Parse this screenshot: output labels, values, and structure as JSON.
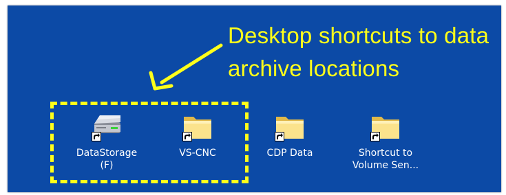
{
  "annotation": {
    "text": "Desktop shortcuts to data\narchive locations",
    "color": "#ffff1a"
  },
  "desktop": {
    "background_color": "#0c4aa6",
    "icons": [
      {
        "label": "DataStorage\n(F)",
        "icon": "drive-icon",
        "shortcut": true
      },
      {
        "label": "VS-CNC",
        "icon": "folder-icon",
        "shortcut": true
      },
      {
        "label": "CDP Data",
        "icon": "folder-icon",
        "shortcut": true
      },
      {
        "label": "Shortcut to\nVolume Sen...",
        "icon": "folder-icon",
        "shortcut": true
      }
    ]
  }
}
